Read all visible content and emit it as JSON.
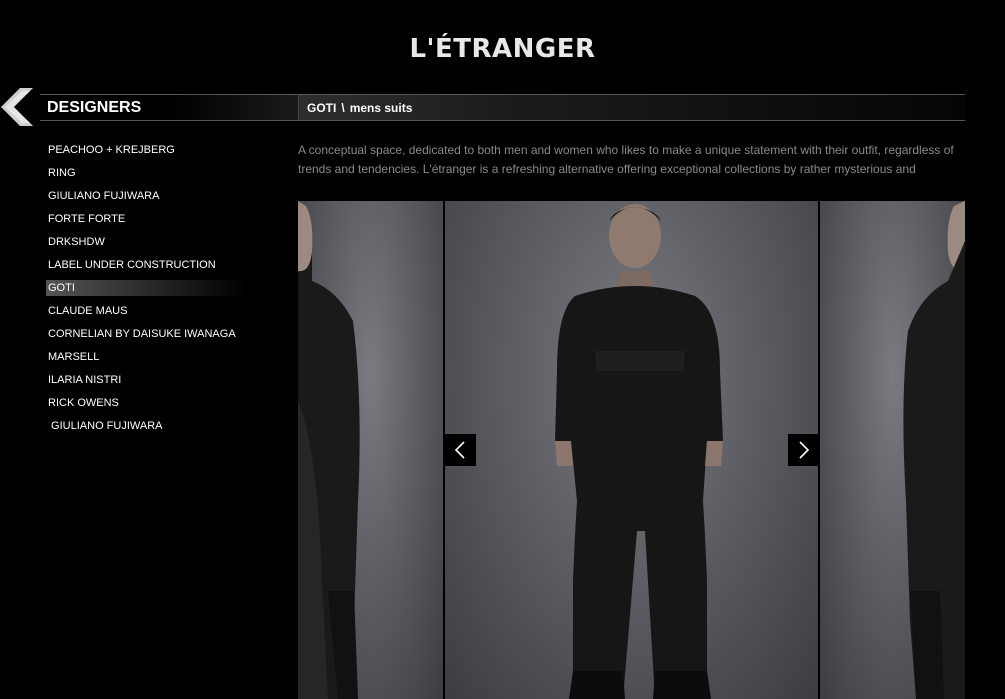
{
  "brand": {
    "logo_text": "L'ÉTRANGER"
  },
  "sidebar": {
    "title": "DESIGNERS",
    "items": [
      {
        "label": "PEACHOO + KREJBERG",
        "active": false
      },
      {
        "label": "RING",
        "active": false
      },
      {
        "label": "GIULIANO FUJIWARA",
        "active": false
      },
      {
        "label": "FORTE FORTE",
        "active": false
      },
      {
        "label": "DRKSHDW",
        "active": false
      },
      {
        "label": "LABEL UNDER CONSTRUCTION",
        "active": false
      },
      {
        "label": "GOTI",
        "active": true
      },
      {
        "label": "CLAUDE MAUS",
        "active": false
      },
      {
        "label": "CORNELIAN BY DAISUKE IWANAGA",
        "active": false
      },
      {
        "label": "MARSELL",
        "active": false
      },
      {
        "label": "ILARIA NISTRI",
        "active": false
      },
      {
        "label": "RICK OWENS",
        "active": false
      },
      {
        "label": " GIULIANO FUJIWARA",
        "active": false
      }
    ]
  },
  "main": {
    "breadcrumb": {
      "designer": "GOTI",
      "separator": "\\",
      "category": "mens suits"
    },
    "description": "A conceptual space, dedicated to both men and women who likes to make a unique statement with their outfit, regardless of trends and tendencies. L'étranger is a refreshing alternative offering exceptional collections by rather mysterious and"
  },
  "colors": {
    "background": "#000000",
    "text": "#ffffff",
    "description": "#8a8a8a",
    "photo_backdrop": "#6b6c71"
  }
}
